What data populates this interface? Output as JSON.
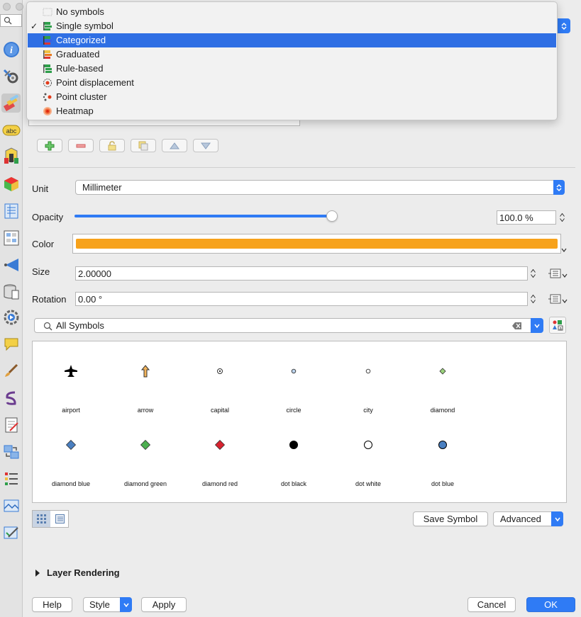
{
  "sidebar": {
    "items": [
      {
        "name": "information-icon"
      },
      {
        "name": "source-settings-icon"
      },
      {
        "name": "symbology-icon"
      },
      {
        "name": "labels-icon"
      },
      {
        "name": "masks-icon"
      },
      {
        "name": "3d-view-icon"
      },
      {
        "name": "fields-icon"
      },
      {
        "name": "attributes-form-icon"
      },
      {
        "name": "joins-icon"
      },
      {
        "name": "auxiliary-storage-icon"
      },
      {
        "name": "actions-icon"
      },
      {
        "name": "display-icon"
      },
      {
        "name": "rendering-icon"
      },
      {
        "name": "temporal-icon"
      },
      {
        "name": "variables-icon"
      },
      {
        "name": "metadata-icon"
      },
      {
        "name": "dependencies-icon"
      },
      {
        "name": "legend-icon"
      },
      {
        "name": "qgis-server-icon"
      },
      {
        "name": "digitizing-icon"
      }
    ]
  },
  "renderer_menu": {
    "selected": "Categorized",
    "checked": "Single symbol",
    "items": [
      {
        "label": "No symbols",
        "icon": "no-symbols-icon"
      },
      {
        "label": "Single symbol",
        "icon": "single-symbol-icon"
      },
      {
        "label": "Categorized",
        "icon": "categorized-icon"
      },
      {
        "label": "Graduated",
        "icon": "graduated-icon"
      },
      {
        "label": "Rule-based",
        "icon": "rule-based-icon"
      },
      {
        "label": "Point displacement",
        "icon": "point-displacement-icon"
      },
      {
        "label": "Point cluster",
        "icon": "point-cluster-icon"
      },
      {
        "label": "Heatmap",
        "icon": "heatmap-icon"
      }
    ]
  },
  "symbol": {
    "unit_label": "Unit",
    "unit_value": "Millimeter",
    "opacity_label": "Opacity",
    "opacity_value": "100.0 %",
    "opacity_fraction": 1.0,
    "color_label": "Color",
    "color_value": "#f7a21b",
    "size_label": "Size",
    "size_value": "2.00000",
    "rotation_label": "Rotation",
    "rotation_value": "0.00 °"
  },
  "library": {
    "search_value": "All Symbols",
    "symbols": [
      {
        "name": "airport",
        "shape": "airplane",
        "color": "#000000"
      },
      {
        "name": "arrow",
        "shape": "arrow",
        "color": "#f2b35a"
      },
      {
        "name": "capital",
        "shape": "ring-dot",
        "color": "#ffffff"
      },
      {
        "name": "circle",
        "shape": "circle-small",
        "color": "#bcd4ee"
      },
      {
        "name": "city",
        "shape": "circle-small",
        "color": "#ffffff"
      },
      {
        "name": "diamond",
        "shape": "diamond-small",
        "color": "#9ad27b"
      },
      {
        "name": "diamond blue",
        "shape": "diamond",
        "color": "#4a7fc0"
      },
      {
        "name": "diamond green",
        "shape": "diamond",
        "color": "#4caf50"
      },
      {
        "name": "diamond red",
        "shape": "diamond",
        "color": "#d7222f"
      },
      {
        "name": "dot  black",
        "shape": "dot",
        "color": "#000000"
      },
      {
        "name": "dot  white",
        "shape": "dot",
        "color": "#ffffff"
      },
      {
        "name": "dot blue",
        "shape": "dot",
        "color": "#4a7fc0"
      }
    ]
  },
  "buttons": {
    "save_symbol": "Save Symbol",
    "advanced": "Advanced",
    "help": "Help",
    "style": "Style",
    "apply": "Apply",
    "cancel": "Cancel",
    "ok": "OK"
  },
  "layer_rendering": {
    "label": "Layer Rendering"
  },
  "colors": {
    "accent": "#2f6fe4",
    "ok_button": "#2f7bf5"
  }
}
